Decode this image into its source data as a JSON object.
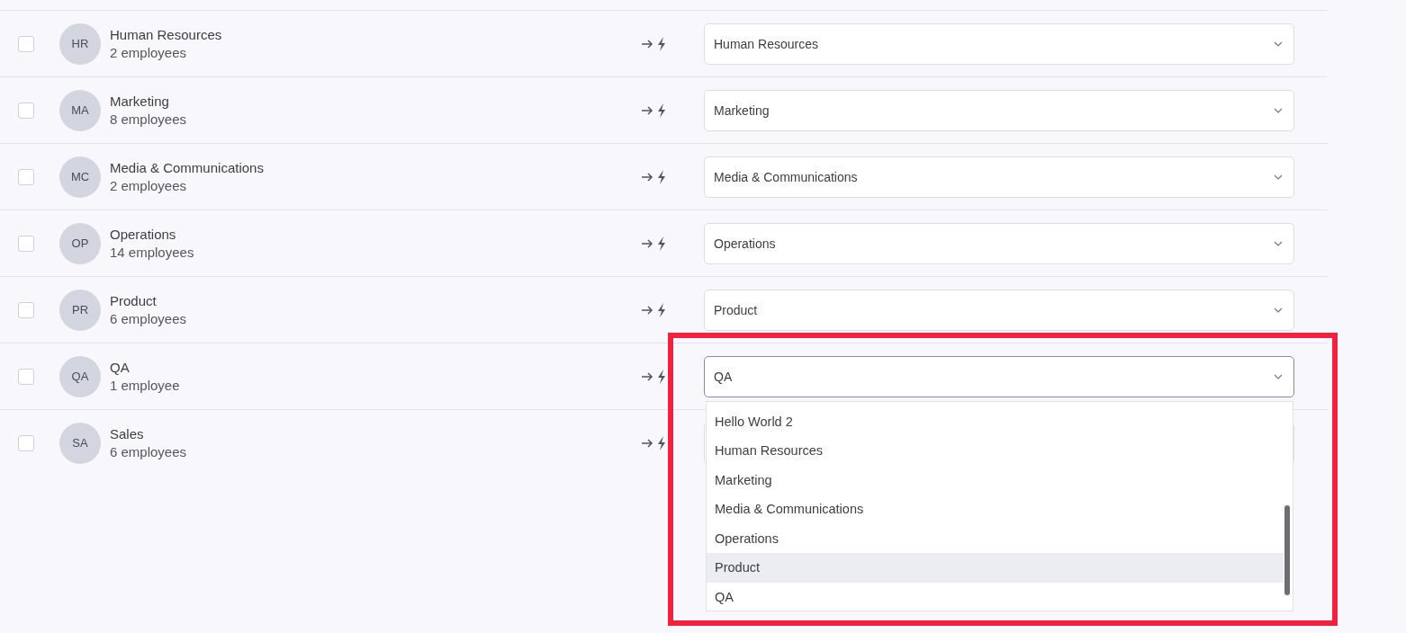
{
  "rows": [
    {
      "initials": "HR",
      "name": "Human Resources",
      "count": "2 employees",
      "checked": false,
      "mapping": "Human Resources",
      "open": false
    },
    {
      "initials": "MA",
      "name": "Marketing",
      "count": "8 employees",
      "checked": false,
      "mapping": "Marketing",
      "open": false
    },
    {
      "initials": "MC",
      "name": "Media & Communications",
      "count": "2 employees",
      "checked": false,
      "mapping": "Media & Communications",
      "open": false
    },
    {
      "initials": "OP",
      "name": "Operations",
      "count": "14 employees",
      "checked": false,
      "mapping": "Operations",
      "open": false
    },
    {
      "initials": "PR",
      "name": "Product",
      "count": "6 employees",
      "checked": false,
      "mapping": "Product",
      "open": false
    },
    {
      "initials": "QA",
      "name": "QA",
      "count": "1 employee",
      "checked": false,
      "mapping": "QA",
      "open": true
    },
    {
      "initials": "SA",
      "name": "Sales",
      "count": "6 employees",
      "checked": false,
      "open": false
    }
  ],
  "dropdown": {
    "options": [
      {
        "label": "Hello World 2",
        "hovered": false
      },
      {
        "label": "Human Resources",
        "hovered": false
      },
      {
        "label": "Marketing",
        "hovered": false
      },
      {
        "label": "Media & Communications",
        "hovered": false
      },
      {
        "label": "Operations",
        "hovered": false
      },
      {
        "label": "Product",
        "hovered": true
      },
      {
        "label": "QA",
        "hovered": false
      }
    ]
  },
  "annotation": {
    "shown": true
  }
}
